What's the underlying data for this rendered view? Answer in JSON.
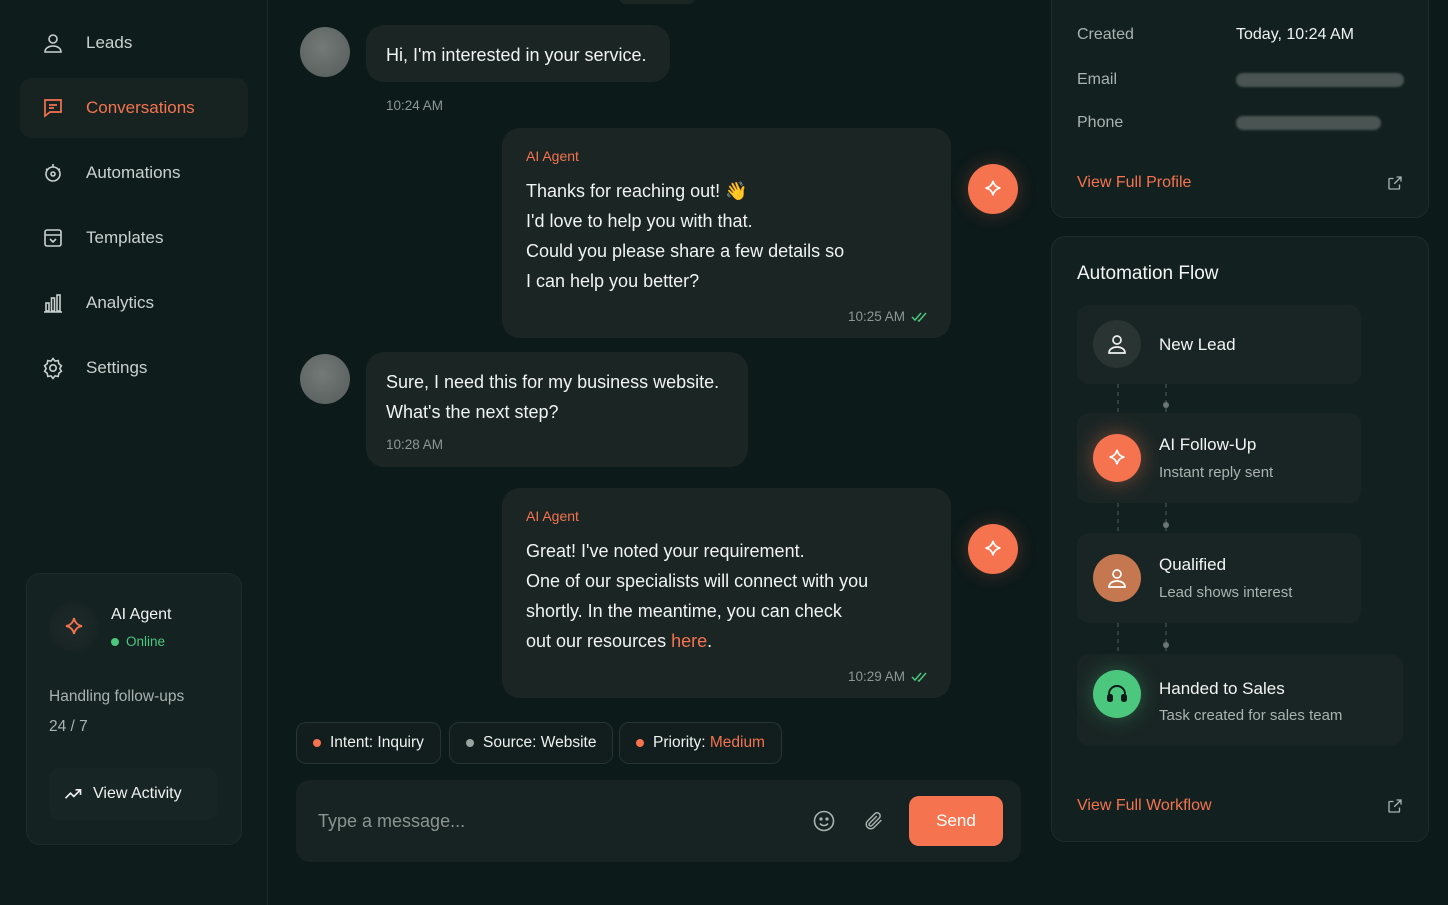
{
  "sidebar": {
    "items": [
      {
        "label": "Leads",
        "icon": "user-icon"
      },
      {
        "label": "Conversations",
        "icon": "chat-icon",
        "active": true
      },
      {
        "label": "Automations",
        "icon": "automation-icon"
      },
      {
        "label": "Templates",
        "icon": "template-icon"
      },
      {
        "label": "Analytics",
        "icon": "analytics-icon"
      },
      {
        "label": "Settings",
        "icon": "gear-icon"
      }
    ],
    "agent_card": {
      "name": "AI Agent",
      "status": "Online",
      "task_line1": "Handling follow-ups",
      "task_line2": "24 / 7",
      "button": "View Activity"
    }
  },
  "chat": {
    "messages": [
      {
        "from": "user",
        "text": "Hi, I'm interested in your service.",
        "time": "10:24 AM"
      },
      {
        "from": "ai",
        "sender": "AI Agent",
        "lines": [
          "Thanks for reaching out! 👋",
          "I'd love to help you with that.",
          "Could you please share a few details so",
          "I can help you better?"
        ],
        "time": "10:25 AM"
      },
      {
        "from": "user",
        "lines": [
          "Sure, I need this for my business website.",
          "What's the next step?"
        ],
        "time": "10:28 AM"
      },
      {
        "from": "ai",
        "sender": "AI Agent",
        "lines": [
          "Great! I've noted your requirement.",
          "One of our specialists will connect with you",
          "shortly. In the meantime, you can check",
          "out our resources "
        ],
        "link": "here",
        "link_suffix": ".",
        "time": "10:29 AM"
      }
    ],
    "tags": [
      {
        "label": "Intent: Inquiry",
        "dot": "#f5734f"
      },
      {
        "label": "Source: Website",
        "dot": "#9aa4a1"
      },
      {
        "label": "Priority: ",
        "value": "Medium",
        "dot": "#f5734f"
      }
    ],
    "composer": {
      "placeholder": "Type a message...",
      "send": "Send"
    }
  },
  "profile": {
    "created_label": "Created",
    "created_value": "Today, 10:24 AM",
    "email_label": "Email",
    "phone_label": "Phone",
    "link": "View Full Profile"
  },
  "flow": {
    "title": "Automation Flow",
    "steps": [
      {
        "title": "New Lead",
        "sub": ""
      },
      {
        "title": "AI Follow-Up",
        "sub": "Instant reply sent"
      },
      {
        "title": "Qualified",
        "sub": "Lead shows interest"
      },
      {
        "title": "Handed to Sales",
        "sub": "Task created for sales team"
      }
    ],
    "link": "View Full Workflow"
  },
  "colors": {
    "accent": "#f5734f",
    "online": "#4cc77e",
    "sales": "#4cc77e",
    "qualified": "#c5774f"
  }
}
